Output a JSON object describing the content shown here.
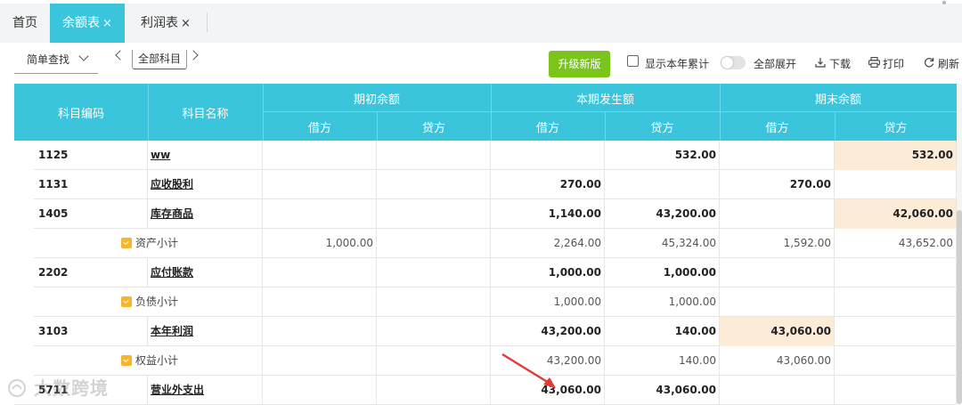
{
  "tabs": [
    {
      "label": "首页",
      "closable": false,
      "active": false
    },
    {
      "label": "余额表",
      "closable": true,
      "active": true
    },
    {
      "label": "利润表",
      "closable": true,
      "active": false
    }
  ],
  "close_glyph": "×",
  "toolbar": {
    "search_mode": "简单查找",
    "subject_filter": "全部科目",
    "upgrade_label": "升级新版",
    "show_year_label": "显示本年累计",
    "show_year_checked": false,
    "expand_label": "全部展开",
    "expand_on": false,
    "download_label": "下载",
    "print_label": "打印",
    "refresh_label": "刷新"
  },
  "table": {
    "headers": {
      "code": "科目编码",
      "name": "科目名称",
      "opening": "期初余额",
      "current": "本期发生额",
      "closing": "期末余额",
      "debit": "借方",
      "credit": "贷方"
    },
    "rows": [
      {
        "type": "account",
        "code": "1125",
        "name": "ww",
        "open_dr": "",
        "open_cr": "",
        "cur_dr": "",
        "cur_cr": "532.00",
        "close_dr": "",
        "close_cr": "532.00",
        "hl": "close_cr"
      },
      {
        "type": "account",
        "code": "1131",
        "name": "应收股利",
        "open_dr": "",
        "open_cr": "",
        "cur_dr": "270.00",
        "cur_cr": "",
        "close_dr": "270.00",
        "close_cr": "",
        "hl": ""
      },
      {
        "type": "account",
        "code": "1405",
        "name": "库存商品",
        "open_dr": "",
        "open_cr": "",
        "cur_dr": "1,140.00",
        "cur_cr": "43,200.00",
        "close_dr": "",
        "close_cr": "42,060.00",
        "hl": "close_cr"
      },
      {
        "type": "subtotal",
        "code": "",
        "name": "资产小计",
        "open_dr": "1,000.00",
        "open_cr": "",
        "cur_dr": "2,264.00",
        "cur_cr": "45,324.00",
        "close_dr": "1,592.00",
        "close_cr": "43,652.00",
        "hl": ""
      },
      {
        "type": "account",
        "code": "2202",
        "name": "应付账款",
        "open_dr": "",
        "open_cr": "",
        "cur_dr": "1,000.00",
        "cur_cr": "1,000.00",
        "close_dr": "",
        "close_cr": "",
        "hl": ""
      },
      {
        "type": "subtotal",
        "code": "",
        "name": "负债小计",
        "open_dr": "",
        "open_cr": "",
        "cur_dr": "1,000.00",
        "cur_cr": "1,000.00",
        "close_dr": "",
        "close_cr": "",
        "hl": ""
      },
      {
        "type": "account",
        "code": "3103",
        "name": "本年利润",
        "open_dr": "",
        "open_cr": "",
        "cur_dr": "43,200.00",
        "cur_cr": "140.00",
        "close_dr": "43,060.00",
        "close_cr": "",
        "hl": "close_dr"
      },
      {
        "type": "subtotal",
        "code": "",
        "name": "权益小计",
        "open_dr": "",
        "open_cr": "",
        "cur_dr": "43,200.00",
        "cur_cr": "140.00",
        "close_dr": "43,060.00",
        "close_cr": "",
        "hl": ""
      },
      {
        "type": "account",
        "code": "5711",
        "name": "营业外支出",
        "open_dr": "",
        "open_cr": "",
        "cur_dr": "43,060.00",
        "cur_cr": "43,060.00",
        "close_dr": "",
        "close_cr": "",
        "hl": ""
      }
    ]
  },
  "colors": {
    "header_bg": "#3bc5dc",
    "active_tab_bg": "#3bc5dc",
    "upgrade_bg": "#7ac41c",
    "highlight_cell": "#fcecd7",
    "subtotal_icon": "#f5b52d",
    "annotation_arrow": "#e53935"
  },
  "icons": {
    "search_chevron": "chevron-down-icon",
    "prev": "chevron-left-icon",
    "next": "chevron-right-icon",
    "download": "download-icon",
    "print": "printer-icon",
    "refresh": "refresh-icon",
    "subtotal": "subtotal-icon",
    "annotation": "red-arrow-icon"
  },
  "watermark": "大数跨境"
}
